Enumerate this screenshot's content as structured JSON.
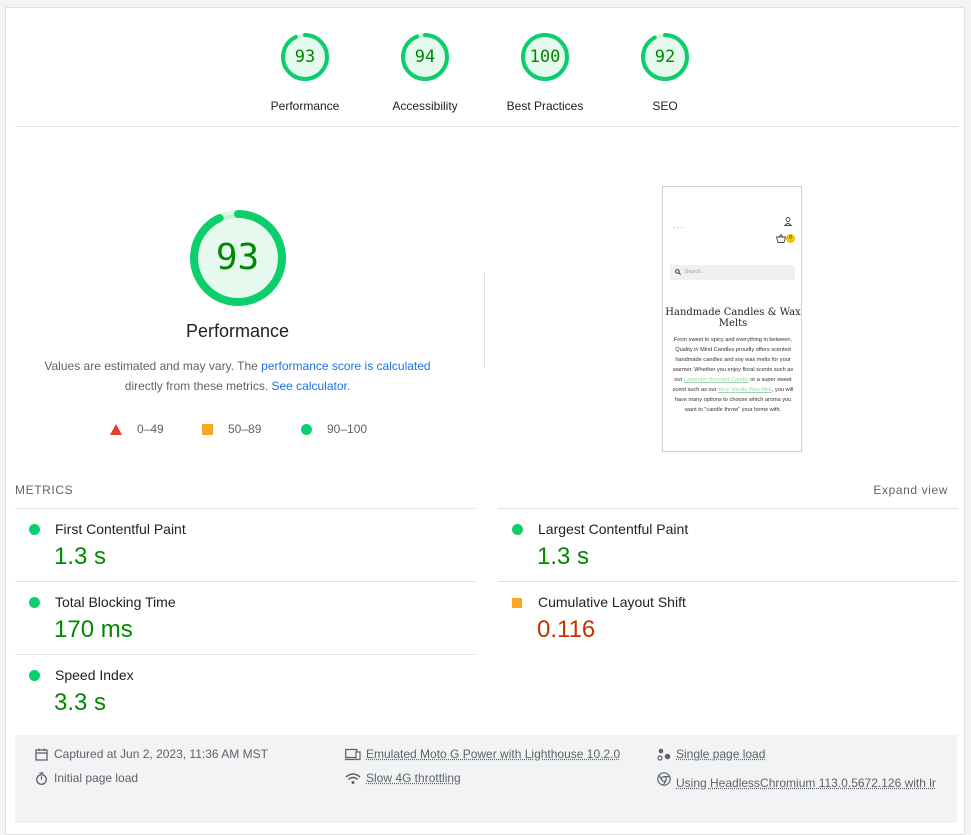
{
  "categories": [
    {
      "label": "Performance",
      "score": 93
    },
    {
      "label": "Accessibility",
      "score": 94
    },
    {
      "label": "Best Practices",
      "score": 100
    },
    {
      "label": "SEO",
      "score": 92
    }
  ],
  "performance": {
    "score": 93,
    "title": "Performance",
    "desc_part1": "Values are estimated and may vary. The ",
    "desc_link1": "performance score is calculated",
    "desc_part2": "directly from these metrics. ",
    "desc_link2": "See calculator.",
    "legend": {
      "fail": "0–49",
      "average": "50–89",
      "pass": "90–100"
    }
  },
  "preview": {
    "menu": "···",
    "cart_count": "0",
    "search_placeholder": "Search...",
    "heading": "Handmade Candles & Wax Melts",
    "text1": "From sweet to spicy and everything in between, Quality in Mind Candles proudly offers scented handmade candles and soy wax melts for your warmer. Whether you enjoy floral scents such as our ",
    "link1": "Lavender Scented Candle",
    "text2": " or a super sweet scent such as our ",
    "link2": "Very Vanilla Wax Melt",
    "text3": ", you will have many options to choose which aroma you want to \"candle throw\" your home with."
  },
  "metrics": {
    "header": "METRICS",
    "expand": "Expand view",
    "items": [
      {
        "title": "First Contentful Paint",
        "value": "1.3 s",
        "rating": "pass"
      },
      {
        "title": "Largest Contentful Paint",
        "value": "1.3 s",
        "rating": "pass"
      },
      {
        "title": "Total Blocking Time",
        "value": "170 ms",
        "rating": "pass"
      },
      {
        "title": "Cumulative Layout Shift",
        "value": "0.116",
        "rating": "average"
      },
      {
        "title": "Speed Index",
        "value": "3.3 s",
        "rating": "pass"
      }
    ]
  },
  "runtime": {
    "captured": "Captured at Jun 2, 2023, 11:36 AM MST",
    "initial_load": "Initial page load",
    "device": "Emulated Moto G Power with Lighthouse 10.2.0",
    "throttling": "Slow 4G throttling",
    "session": "Single page load",
    "browser": "Using HeadlessChromium 113.0.5672.126 with lr"
  },
  "colors": {
    "pass": "#0cce6b",
    "pass_text": "#008800",
    "average": "#f9a825",
    "average_text": "#c33300",
    "fail": "#eb3b2f",
    "link": "#1a73e8"
  }
}
